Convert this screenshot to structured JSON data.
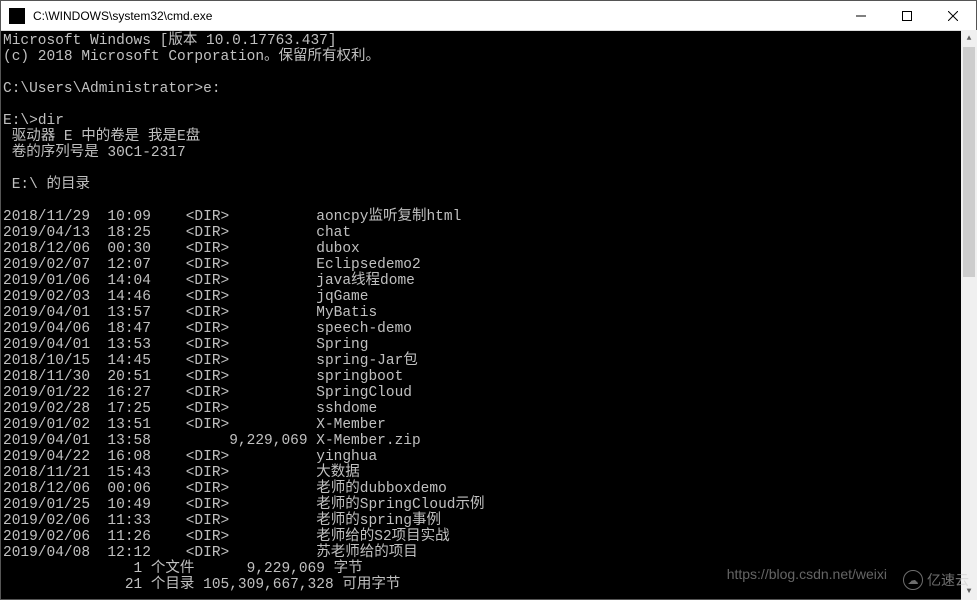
{
  "titlebar": {
    "title": "C:\\WINDOWS\\system32\\cmd.exe"
  },
  "header": {
    "line1": "Microsoft Windows [版本 10.0.17763.437]",
    "line2": "(c) 2018 Microsoft Corporation。保留所有权利。"
  },
  "prompts": {
    "p1": "C:\\Users\\Administrator>",
    "cmd1": "e:",
    "p2": "E:\\>",
    "cmd2": "dir",
    "vol_line": " 驱动器 E 中的卷是 我是E盘",
    "serial_line": " 卷的序列号是 30C1-2317",
    "dir_of": " E:\\ 的目录"
  },
  "entries": [
    {
      "date": "2018/11/29",
      "time": "10:09",
      "type": "<DIR>",
      "size": "",
      "name": "aoncpy监听复制html"
    },
    {
      "date": "2019/04/13",
      "time": "18:25",
      "type": "<DIR>",
      "size": "",
      "name": "chat"
    },
    {
      "date": "2018/12/06",
      "time": "00:30",
      "type": "<DIR>",
      "size": "",
      "name": "dubox"
    },
    {
      "date": "2019/02/07",
      "time": "12:07",
      "type": "<DIR>",
      "size": "",
      "name": "Eclipsedemo2"
    },
    {
      "date": "2019/01/06",
      "time": "14:04",
      "type": "<DIR>",
      "size": "",
      "name": "java线程dome"
    },
    {
      "date": "2019/02/03",
      "time": "14:46",
      "type": "<DIR>",
      "size": "",
      "name": "jqGame"
    },
    {
      "date": "2019/04/01",
      "time": "13:57",
      "type": "<DIR>",
      "size": "",
      "name": "MyBatis"
    },
    {
      "date": "2019/04/06",
      "time": "18:47",
      "type": "<DIR>",
      "size": "",
      "name": "speech-demo"
    },
    {
      "date": "2019/04/01",
      "time": "13:53",
      "type": "<DIR>",
      "size": "",
      "name": "Spring"
    },
    {
      "date": "2018/10/15",
      "time": "14:45",
      "type": "<DIR>",
      "size": "",
      "name": "spring-Jar包"
    },
    {
      "date": "2018/11/30",
      "time": "20:51",
      "type": "<DIR>",
      "size": "",
      "name": "springboot"
    },
    {
      "date": "2019/01/22",
      "time": "16:27",
      "type": "<DIR>",
      "size": "",
      "name": "SpringCloud"
    },
    {
      "date": "2019/02/28",
      "time": "17:25",
      "type": "<DIR>",
      "size": "",
      "name": "sshdome"
    },
    {
      "date": "2019/01/02",
      "time": "13:51",
      "type": "<DIR>",
      "size": "",
      "name": "X-Member"
    },
    {
      "date": "2019/04/01",
      "time": "13:58",
      "type": "",
      "size": "9,229,069",
      "name": "X-Member.zip"
    },
    {
      "date": "2019/04/22",
      "time": "16:08",
      "type": "<DIR>",
      "size": "",
      "name": "yinghua"
    },
    {
      "date": "2018/11/21",
      "time": "15:43",
      "type": "<DIR>",
      "size": "",
      "name": "大数据"
    },
    {
      "date": "2018/12/06",
      "time": "00:06",
      "type": "<DIR>",
      "size": "",
      "name": "老师的dubboxdemo"
    },
    {
      "date": "2019/01/25",
      "time": "10:49",
      "type": "<DIR>",
      "size": "",
      "name": "老师的SpringCloud示例"
    },
    {
      "date": "2019/02/06",
      "time": "11:33",
      "type": "<DIR>",
      "size": "",
      "name": "老师的spring事例"
    },
    {
      "date": "2019/02/06",
      "time": "11:26",
      "type": "<DIR>",
      "size": "",
      "name": "老师给的S2项目实战"
    },
    {
      "date": "2019/04/08",
      "time": "12:12",
      "type": "<DIR>",
      "size": "",
      "name": "苏老师给的项目"
    }
  ],
  "summary": {
    "files": "               1 个文件      9,229,069 字节",
    "dirs": "              21 个目录 105,309,667,328 可用字节"
  },
  "watermarks": {
    "w1": "https://blog.csdn.net/weixi",
    "w2": "亿速云"
  }
}
